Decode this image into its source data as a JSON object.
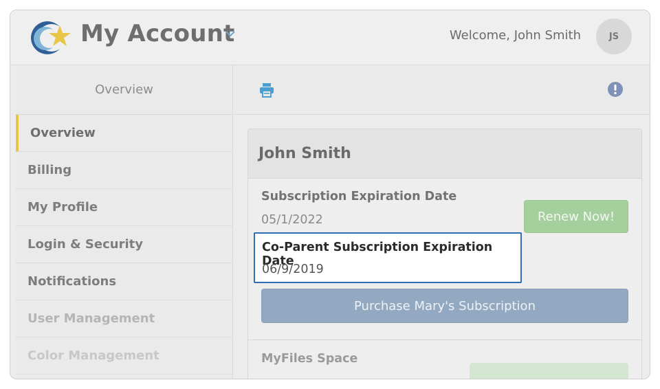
{
  "header": {
    "app_title": "My Account",
    "welcome_text": "Welcome, John Smith",
    "avatar_initials": "JS"
  },
  "sidebar": {
    "heading": "Overview",
    "items": [
      {
        "label": "Overview"
      },
      {
        "label": "Billing"
      },
      {
        "label": "My Profile"
      },
      {
        "label": "Login & Security"
      },
      {
        "label": "Notifications"
      },
      {
        "label": "User Management"
      },
      {
        "label": "Color Management"
      }
    ]
  },
  "toolbar": {
    "icons": [
      "print-icon",
      "alert-icon"
    ]
  },
  "card": {
    "name": "John Smith",
    "subscription_label": "Subscription Expiration Date",
    "subscription_value": "05/1/2022",
    "renew_button": "Renew Now!",
    "coparent_label": "Co-Parent Subscription Expiration Date",
    "coparent_value": "06/9/2019",
    "purchase_button": "Purchase Mary's Subscription",
    "myfiles_label": "MyFiles Space"
  },
  "colors": {
    "accent_active": "#e8c547",
    "highlight_border": "#2f6eb5",
    "renew_green": "#a5cf9d",
    "purchase_blue": "#93a8c1",
    "icon_blue": "#4a9fd0"
  }
}
